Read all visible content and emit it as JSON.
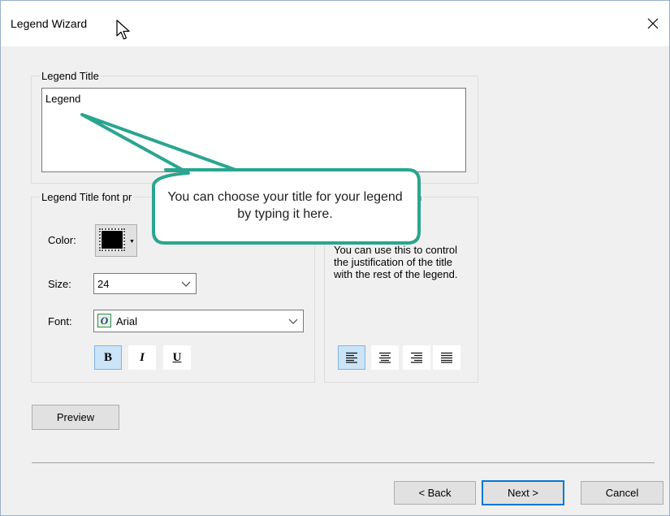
{
  "window": {
    "title": "Legend Wizard"
  },
  "title_group": {
    "label": "Legend Title",
    "value": "Legend"
  },
  "font_group": {
    "label": "Legend Title font pr",
    "color_label": "Color:",
    "color_value": "#000000",
    "size_label": "Size:",
    "size_value": "24",
    "font_label": "Font:",
    "font_value": "Arial",
    "bold_label": "B",
    "italic_label": "I",
    "underline_label": "U",
    "bold_active": true
  },
  "align_group": {
    "label": "n",
    "description": "You can use this to control the justification of the title with the rest of the legend.",
    "buttons": [
      "align-left-icon",
      "align-center-icon",
      "align-right-icon",
      "align-justify-icon"
    ],
    "active": "align-left-icon"
  },
  "callout": {
    "text": "You can choose your title for your legend by typing it here.",
    "border_color": "#2aa58f"
  },
  "buttons": {
    "preview": "Preview",
    "back": "< Back",
    "next": "Next >",
    "cancel": "Cancel"
  },
  "colors": {
    "accent": "#0078d7",
    "active_fill": "#cce4f7",
    "dialog_bg": "#f0f0f0"
  }
}
